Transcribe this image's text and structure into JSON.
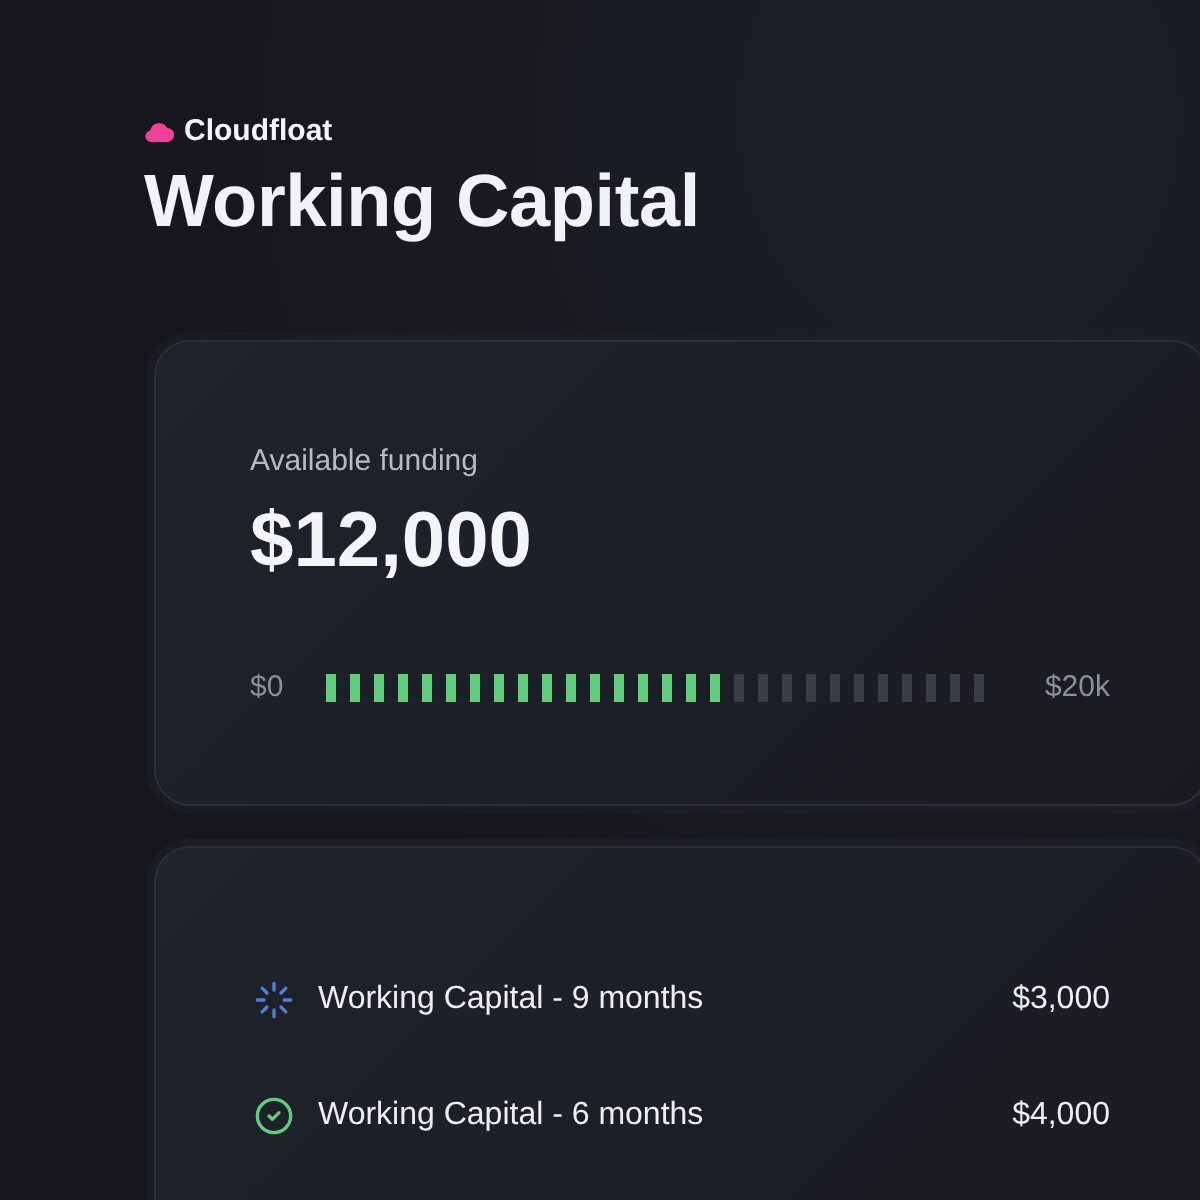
{
  "brand": {
    "name": "Cloudfloat"
  },
  "title": "Working Capital",
  "funding_card": {
    "label": "Available funding",
    "amount": "$12,000",
    "meter": {
      "min_label": "$0",
      "max_label": "$20k",
      "level": 0.6
    }
  },
  "loans": [
    {
      "kind": "pending",
      "name": "Working Capital - 9 months",
      "amount": "$3,000"
    },
    {
      "kind": "completed",
      "name": "Working Capital - 6 months",
      "amount": "$4,000"
    }
  ]
}
